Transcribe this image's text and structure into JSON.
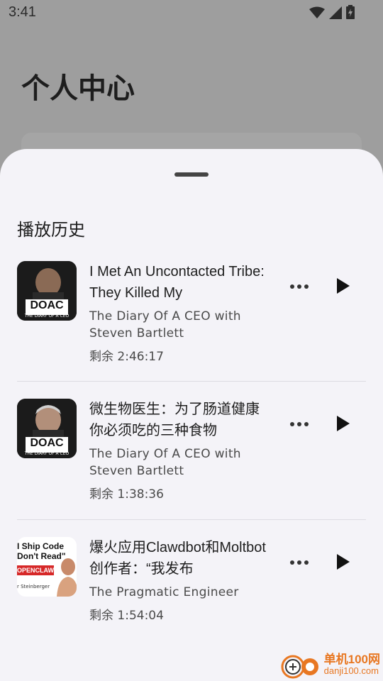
{
  "status_bar": {
    "time": "3:41",
    "icons": [
      "wifi-icon",
      "signal-icon",
      "battery-icon"
    ]
  },
  "background_page": {
    "title": "个人中心"
  },
  "sheet": {
    "title": "播放历史",
    "items": [
      {
        "thumb_brand": "DOAC",
        "thumb_sub": "THE DIARY OF A CEO",
        "title": "I Met An Uncontacted Tribe: They Killed My",
        "author": "The Diary Of A CEO with Steven Bartlett",
        "remaining": "剩余 2:46:17"
      },
      {
        "thumb_brand": "DOAC",
        "thumb_sub": "THE DIARY OF A CEO",
        "title": "微生物医生：为了肠道健康你必须吃的三种食物",
        "author": "The Diary Of A CEO with Steven Bartlett",
        "remaining": "剩余 1:38:36"
      },
      {
        "thumb_line1": "I Ship Code",
        "thumb_line2": "Don't Read\"",
        "thumb_line3": "OPENCLAW",
        "thumb_line4": "r Steinberger",
        "title": "爆火应用Clawdbot和Moltbot创作者：“我发布",
        "author": "The Pragmatic Engineer",
        "remaining": "剩余 1:54:04"
      }
    ]
  },
  "watermark": {
    "name": "单机100网",
    "url": "danji100.com"
  },
  "colors": {
    "sheet_bg": "#f4f3f8",
    "scrim": "#9e9e9e",
    "watermark": "#e87722"
  }
}
